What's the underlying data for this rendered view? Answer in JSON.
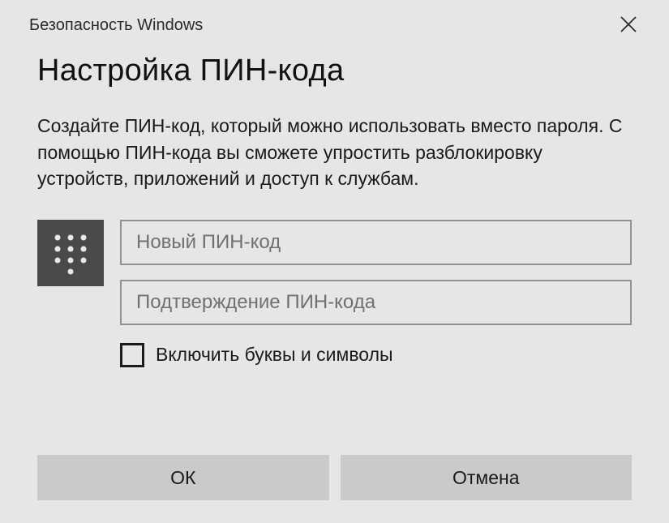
{
  "titlebar": {
    "text": "Безопасность Windows"
  },
  "heading": "Настройка ПИН-кода",
  "description": "Создайте ПИН-код, который можно использовать вместо пароля. С помощью ПИН-кода вы сможете упростить разблокировку устройств, приложений и доступ к службам.",
  "inputs": {
    "new_pin_placeholder": "Новый ПИН-код",
    "confirm_pin_placeholder": "Подтверждение ПИН-кода"
  },
  "checkbox": {
    "label": "Включить буквы и символы"
  },
  "buttons": {
    "ok": "ОК",
    "cancel": "Отмена"
  }
}
